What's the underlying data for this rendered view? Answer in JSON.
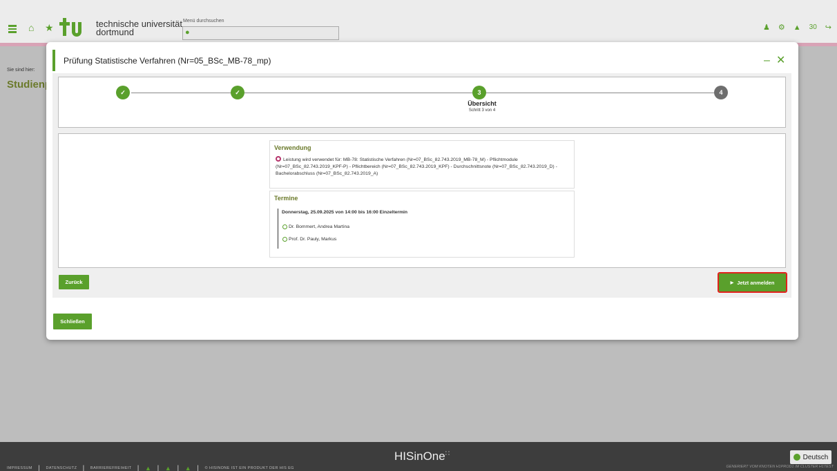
{
  "header": {
    "logo_line1": "technische universität",
    "logo_line2": "dortmund",
    "search_label": "Menü durchsuchen",
    "search_placeholder": "",
    "notification_count": "30",
    "icons": [
      "menu-icon",
      "home-icon",
      "star-icon",
      "search-icon",
      "user-icon",
      "gear-icon",
      "bell-icon",
      "logout-icon"
    ]
  },
  "page": {
    "breadcrumb": "Sie sind hier:",
    "title": "Studienp"
  },
  "modal": {
    "title": "Prüfung Statistische Verfahren (Nr=05_BSc_MB-78_mp)",
    "steps": [
      {
        "number": "1",
        "state": "done"
      },
      {
        "number": "2",
        "state": "done"
      },
      {
        "number": "3",
        "state": "current",
        "title": "Übersicht",
        "subtitle": "Schritt 3 von 4"
      },
      {
        "number": "4",
        "state": "todo"
      }
    ],
    "verwendung": {
      "heading": "Verwendung",
      "text": "Leistung wird verwendet für: MB-78: Statistische Verfahren (Nr=07_BSc_82.743.2019_MB-78_M) - Pflichtmodule (Nr=07_BSc_82.743.2019_KPF-P) - Pflichtbereich (Nr=07_BSc_82.743.2019_KPF) - Durchschnittsnote (Nr=07_BSc_82.743.2019_D) - Bachelorabschluss (Nr=07_BSc_82.743.2019_A)"
    },
    "termine": {
      "heading": "Termine",
      "date": "Donnerstag, 25.09.2025 von 14:00 bis 16:00 Einzeltermin",
      "persons": [
        "Dr. Bommert, Andrea Martina",
        "Prof. Dr. Pauly, Markus"
      ]
    },
    "buttons": {
      "back": "Zurück",
      "register": "Jetzt anmelden",
      "close": "Schließen"
    },
    "accent_color": "#5aa02c"
  },
  "footer": {
    "links": [
      "IMPRESSUM",
      "DATENSCHUTZ",
      "BARRIEREFREIHEIT"
    ],
    "product": "© HISINONE IST EIN PRODUKT DER HIS EG",
    "brand": "HISinOne",
    "generated": "GENERIERT VOM KNOTEN H1PROD1 IM CLUSTER H1TEST",
    "language": "Deutsch"
  }
}
